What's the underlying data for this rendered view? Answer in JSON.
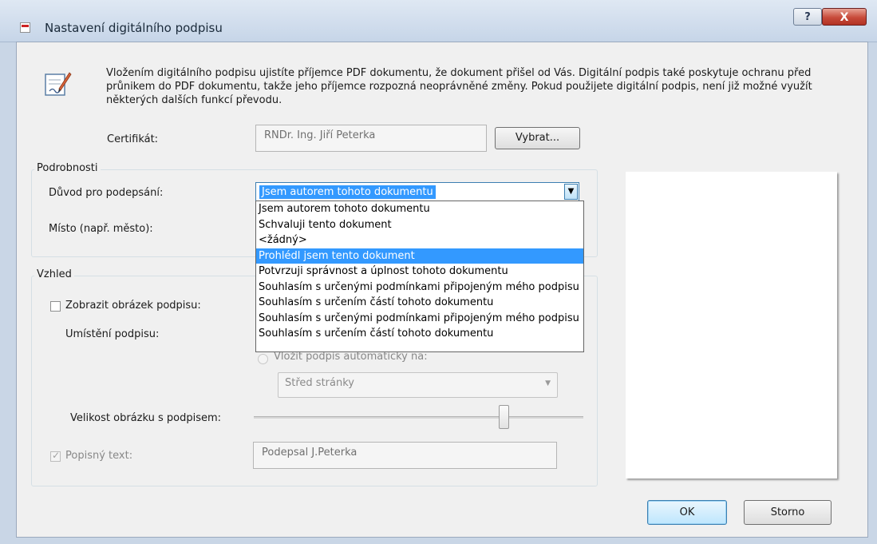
{
  "window": {
    "title": "Nastavení digitálního podpisu",
    "help_label": "?",
    "close_label": "X"
  },
  "description": "Vložením digitálního podpisu ujistíte příjemce PDF dokumentu, že dokument přišel od Vás. Digitální podpis také poskytuje ochranu před průnikem do PDF dokumentu, takže jeho příjemce rozpozná neoprávněné změny. Pokud použijete digitální podpis, není již možné využít některých dalších funkcí převodu.",
  "certificate": {
    "label": "Certifikát:",
    "value": "RNDr. Ing. Jiří Peterka",
    "select_button": "Vybrat..."
  },
  "details": {
    "group_title": "Podrobnosti",
    "reason_label": "Důvod pro podepsání:",
    "reason_value": "Jsem autorem tohoto dokumentu",
    "location_label": "Místo (např. město):",
    "reason_options": [
      "Jsem autorem tohoto dokumentu",
      "Schvaluji tento dokument",
      "<žádný>",
      "Prohlédl jsem tento dokument",
      "Potvrzuji správnost a úplnost tohoto dokumentu",
      "Souhlasím s určenými podmínkami připojeným mého podpisu",
      "Souhlasím s určením částí tohoto dokumentu",
      "Souhlasím s určenými podmínkami připojeným mého podpisu",
      "Souhlasím s určením částí tohoto dokumentu"
    ],
    "highlighted_option": "Prohlédl jsem tento dokument"
  },
  "appearance": {
    "group_title": "Vzhled",
    "show_image_label": "Zobrazit obrázek podpisu:",
    "placement_label": "Umístění podpisu:",
    "auto_place_label": "Vložit podpis automaticky na:",
    "auto_place_value": "Střed stránky",
    "size_label": "Velikost obrázku s podpisem:",
    "size_fraction": 0.76,
    "desc_text_label": "Popisný text:",
    "desc_text_value": "Podepsal J.Peterka"
  },
  "buttons": {
    "ok": "OK",
    "cancel": "Storno"
  }
}
